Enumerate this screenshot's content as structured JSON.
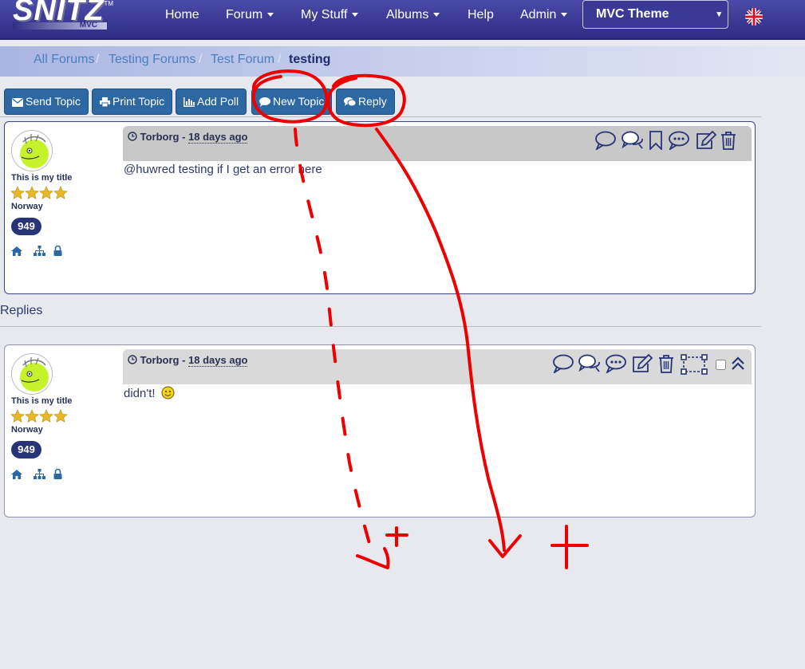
{
  "app": {
    "logo_text": "SNITZ",
    "logo_sub": "MVC",
    "logo_tm": "TM"
  },
  "nav": {
    "items": [
      {
        "label": "Home",
        "has_caret": false
      },
      {
        "label": "Forum",
        "has_caret": true
      },
      {
        "label": "My Stuff",
        "has_caret": true
      },
      {
        "label": "Albums",
        "has_caret": true
      },
      {
        "label": "Help",
        "has_caret": false
      },
      {
        "label": "Admin",
        "has_caret": true
      }
    ],
    "theme_selected": "MVC Theme",
    "theme_arrow": "▾",
    "language_icon": "uk-flag-icon"
  },
  "breadcrumb": {
    "items": [
      "All Forums",
      "Testing Forums",
      "Test Forum"
    ],
    "separator": "/",
    "active": "testing"
  },
  "toolbar": {
    "buttons": [
      {
        "label": "Send Topic",
        "icon": "envelope-icon"
      },
      {
        "label": "Print Topic",
        "icon": "print-icon"
      },
      {
        "label": "Add Poll",
        "icon": "bar-chart-icon"
      },
      {
        "label": "New Topic",
        "icon": "comment-icon"
      },
      {
        "label": "Reply",
        "icon": "comments-icon"
      }
    ]
  },
  "topic": {
    "author": "Torborg",
    "separator": " - ",
    "date": "18 days ago",
    "user_title": "This is my title",
    "country": "Norway",
    "post_count": "949",
    "stars": 4,
    "body": "@huwred testing if I get an error here"
  },
  "replies_heading": "Replies",
  "reply": {
    "author": "Torborg",
    "separator": " - ",
    "date": "18 days ago",
    "user_title": "This is my title",
    "country": "Norway",
    "post_count": "949",
    "stars": 4,
    "body": "didn't!"
  },
  "colors": {
    "navbar": "#2e2e86",
    "button": "#2d68a3",
    "badge": "#273476",
    "annotation": "#ee0000"
  }
}
